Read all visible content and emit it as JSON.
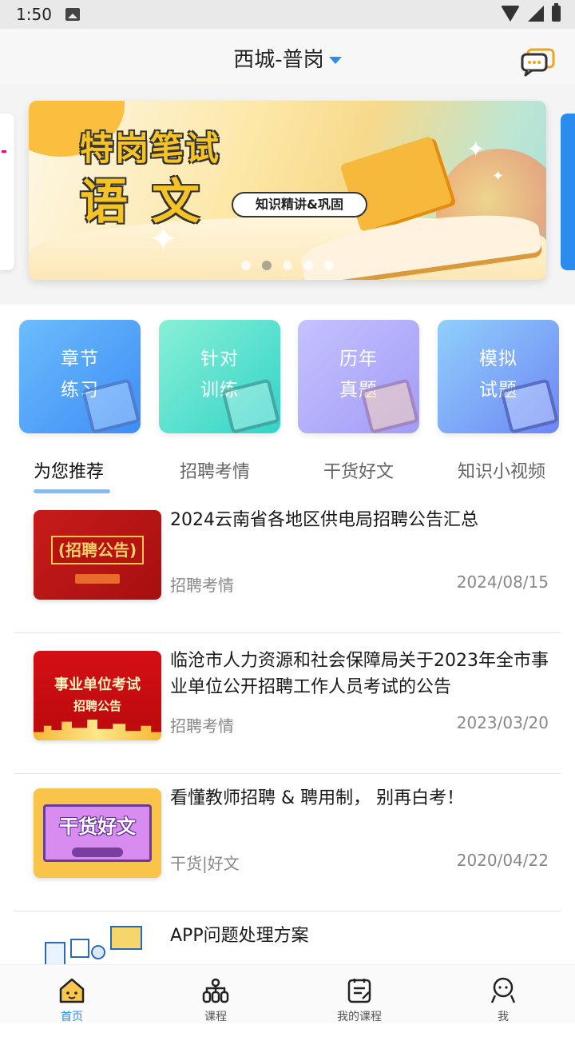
{
  "status_bar": {
    "time": "1:50"
  },
  "header": {
    "location": "西城-普岗"
  },
  "banner": {
    "title": "特岗笔试",
    "subject": "语文",
    "subtitle": "知识精讲&巩固",
    "active_dot": 2,
    "dot_count": 5
  },
  "quick_actions": [
    {
      "line1": "章节",
      "line2": "练习"
    },
    {
      "line1": "针对",
      "line2": "训练"
    },
    {
      "line1": "历年",
      "line2": "真题"
    },
    {
      "line1": "模拟",
      "line2": "试题"
    }
  ],
  "tabs": [
    "为您推荐",
    "招聘考情",
    "干货好文",
    "知识小视频"
  ],
  "active_tab": 0,
  "articles": [
    {
      "title": "2024云南省各地区供电局招聘公告汇总",
      "category": "招聘考情",
      "date": "2024/08/15",
      "thumb_text": "(招聘公告)"
    },
    {
      "title": "临沧市人力资源和社会保障局关于2023年全市事业单位公开招聘工作人员考试的公告",
      "category": "招聘考情",
      "date": "2023/03/20",
      "thumb_text_1": "事业单位考试",
      "thumb_text_2": "招聘公告"
    },
    {
      "title": "看懂教师招聘 & 聘用制， 别再白考！",
      "category": "干货|好文",
      "date": "2020/04/22",
      "thumb_text": "干货好文"
    },
    {
      "title": "APP问题处理方案",
      "category": "",
      "date": ""
    }
  ],
  "bottom_nav": [
    {
      "label": "首页",
      "icon": "home-icon"
    },
    {
      "label": "课程",
      "icon": "course-icon"
    },
    {
      "label": "我的课程",
      "icon": "my-course-icon"
    },
    {
      "label": "我",
      "icon": "profile-icon"
    }
  ],
  "colors": {
    "accent": "#2b8cf0",
    "text": "#1a1a1a",
    "muted": "#888888"
  }
}
